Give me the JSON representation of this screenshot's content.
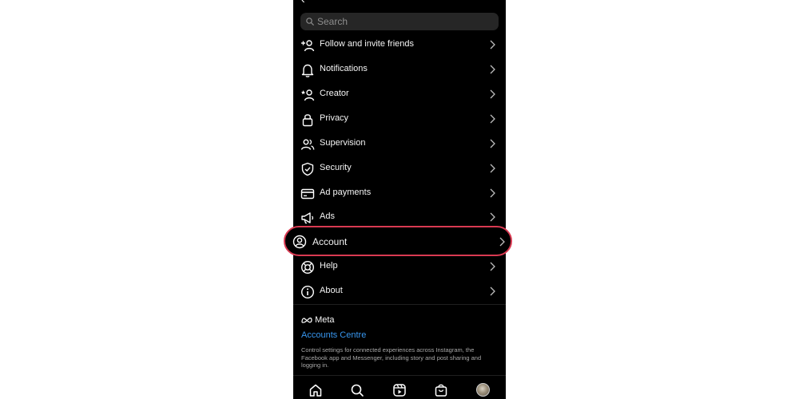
{
  "search": {
    "placeholder": "Search"
  },
  "menu": {
    "items": [
      {
        "label": "Follow and invite friends",
        "icon": "add-person-icon"
      },
      {
        "label": "Notifications",
        "icon": "bell-icon"
      },
      {
        "label": "Creator",
        "icon": "creator-icon"
      },
      {
        "label": "Privacy",
        "icon": "lock-icon"
      },
      {
        "label": "Supervision",
        "icon": "people-icon"
      },
      {
        "label": "Security",
        "icon": "shield-icon"
      },
      {
        "label": "Ad payments",
        "icon": "card-icon"
      },
      {
        "label": "Ads",
        "icon": "megaphone-icon"
      },
      {
        "label": "Account",
        "icon": "user-circle-icon",
        "highlighted": true
      },
      {
        "label": "Help",
        "icon": "lifebuoy-icon"
      },
      {
        "label": "About",
        "icon": "info-icon"
      }
    ]
  },
  "footer": {
    "brand": "Meta",
    "link": "Accounts Centre",
    "description": "Control settings for connected experiences across Instagram, the Facebook app and Messenger, including story and post sharing and logging in."
  },
  "tabbar": {
    "tabs": [
      "home-icon",
      "search-icon",
      "reels-icon",
      "shop-icon",
      "profile-avatar"
    ]
  },
  "colors": {
    "background": "#000000",
    "text": "#f5f5f5",
    "link": "#3897f0",
    "highlight_border": "#d93a52"
  }
}
